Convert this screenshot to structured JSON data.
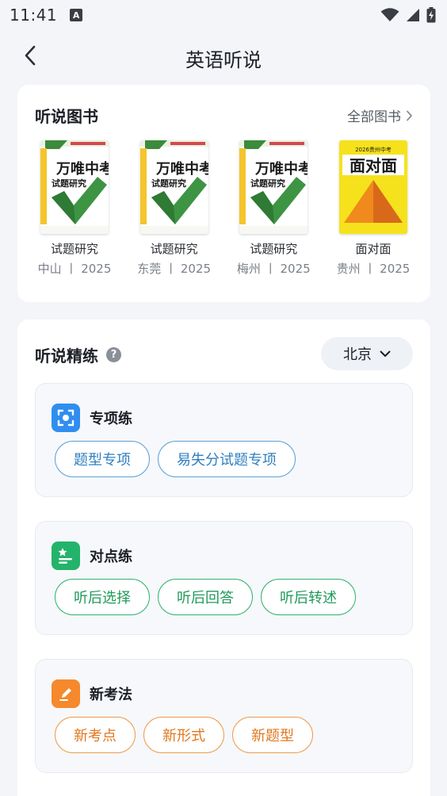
{
  "status_bar": {
    "time": "11:41",
    "notification_icon": "a-badge-icon",
    "right_icons": [
      "wifi-icon",
      "signal-icon",
      "battery-charging-icon"
    ]
  },
  "nav": {
    "title": "英语听说",
    "back_icon": "chevron-left-icon"
  },
  "books_section": {
    "title": "听说图书",
    "all_books_label": "全部图书",
    "books": [
      {
        "name": "试题研究",
        "region": "中山",
        "separator": "丨",
        "year": "2025",
        "cover_label": "万唯中考",
        "cover_sub": "试题研究"
      },
      {
        "name": "试题研究",
        "region": "东莞",
        "separator": "丨",
        "year": "2025",
        "cover_label": "万唯中考",
        "cover_sub": "试题研究"
      },
      {
        "name": "试题研究",
        "region": "梅州",
        "separator": "丨",
        "year": "2025",
        "cover_label": "万唯中考",
        "cover_sub": "试题研究"
      },
      {
        "name": "面对面",
        "region": "贵州",
        "separator": "丨",
        "year": "2025",
        "cover_label": "面对面",
        "cover_sub": "2026贵州中考"
      }
    ]
  },
  "practice_section": {
    "title": "听说精练",
    "city": "北京",
    "modules": [
      {
        "title": "专项练",
        "icon": "scan-focus-icon",
        "color": "#2f8ef0",
        "chips": [
          "题型专项",
          "易失分试题专项"
        ]
      },
      {
        "title": "对点练",
        "icon": "star-list-icon",
        "color": "#24b36b",
        "chips": [
          "听后选择",
          "听后回答",
          "听后转述"
        ]
      },
      {
        "title": "新考法",
        "icon": "pencil-edit-icon",
        "color": "#f5892b",
        "chips": [
          "新考点",
          "新形式",
          "新题型"
        ]
      }
    ]
  }
}
